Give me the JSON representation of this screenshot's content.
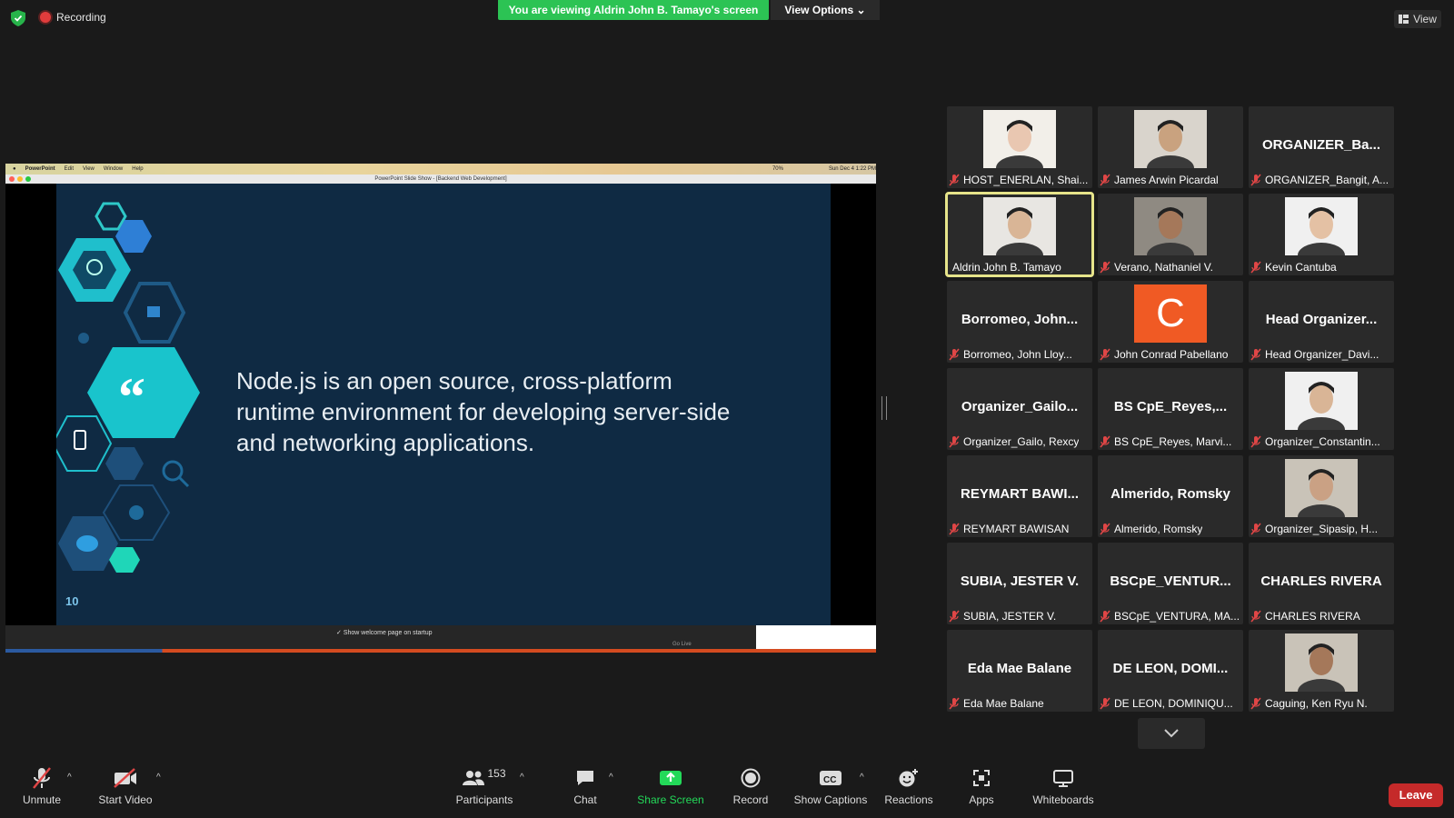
{
  "top": {
    "recording_label": "Recording",
    "viewing_banner": "You are viewing Aldrin John B. Tamayo's screen",
    "view_options_label": "View Options",
    "view_label": "View"
  },
  "shared_screen": {
    "mac_menu": {
      "app": "PowerPoint",
      "items": [
        "Edit",
        "View",
        "Window",
        "Help"
      ],
      "status": "70%",
      "clock": "Sun Dec 4  1:22 PM"
    },
    "window_title": "PowerPoint Slide Show - [Backend Web Development]",
    "slide_text": "Node.js is an open source, cross-platform runtime environment for developing server-side and networking applications.",
    "slide_number": "10",
    "behind_window_text": "Show welcome page on startup",
    "behind_window_go_live": "Go Live"
  },
  "gallery": {
    "tiles": [
      {
        "display": "",
        "label": "HOST_ENERLAN, Shai...",
        "has_video": true,
        "muted": true,
        "active": false
      },
      {
        "display": "",
        "label": "James Arwin Picardal",
        "has_video": true,
        "muted": true,
        "active": false
      },
      {
        "display": "ORGANIZER_Ba...",
        "label": "ORGANIZER_Bangit, A...",
        "has_video": false,
        "muted": true,
        "active": false
      },
      {
        "display": "",
        "label": "Aldrin John B. Tamayo",
        "has_video": true,
        "muted": false,
        "active": true
      },
      {
        "display": "",
        "label": "Verano, Nathaniel V.",
        "has_video": true,
        "muted": true,
        "active": false
      },
      {
        "display": "",
        "label": "Kevin Cantuba",
        "has_video": true,
        "muted": true,
        "active": false
      },
      {
        "display": "Borromeo,  John...",
        "label": "Borromeo, John Lloy...",
        "has_video": false,
        "muted": true,
        "active": false
      },
      {
        "display": "",
        "label": "John Conrad Pabellano",
        "has_video": false,
        "avatar_letter": "C",
        "muted": true,
        "active": false
      },
      {
        "display": "Head  Organizer...",
        "label": "Head Organizer_Davi...",
        "has_video": false,
        "muted": true,
        "active": false
      },
      {
        "display": "Organizer_Gailo...",
        "label": "Organizer_Gailo, Rexcy",
        "has_video": false,
        "muted": true,
        "active": false
      },
      {
        "display": "BS  CpE_Reyes,...",
        "label": "BS CpE_Reyes, Marvi...",
        "has_video": false,
        "muted": true,
        "active": false
      },
      {
        "display": "",
        "label": "Organizer_Constantin...",
        "has_video": true,
        "muted": true,
        "active": false
      },
      {
        "display": "REYMART  BAWI...",
        "label": "REYMART BAWISAN",
        "has_video": false,
        "muted": true,
        "active": false
      },
      {
        "display": "Almerido,  Romsky",
        "label": "Almerido, Romsky",
        "has_video": false,
        "muted": true,
        "active": false
      },
      {
        "display": "",
        "label": "Organizer_Sipasip, H...",
        "has_video": true,
        "muted": true,
        "active": false
      },
      {
        "display": "SUBIA,  JESTER V.",
        "label": "SUBIA, JESTER V.",
        "has_video": false,
        "muted": true,
        "active": false
      },
      {
        "display": "BSCpE_VENTUR...",
        "label": "BSCpE_VENTURA, MA...",
        "has_video": false,
        "muted": true,
        "active": false
      },
      {
        "display": "CHARLES RIVERA",
        "label": "CHARLES RIVERA",
        "has_video": false,
        "muted": true,
        "active": false
      },
      {
        "display": "Eda Mae Balane",
        "label": "Eda Mae Balane",
        "has_video": false,
        "muted": true,
        "active": false
      },
      {
        "display": "DE  LEON,  DOMI...",
        "label": "DE LEON, DOMINIQU...",
        "has_video": false,
        "muted": true,
        "active": false
      },
      {
        "display": "",
        "label": "Caguing, Ken Ryu N.",
        "has_video": true,
        "muted": true,
        "active": false
      }
    ]
  },
  "toolbar": {
    "unmute": "Unmute",
    "start_video": "Start Video",
    "participants": "Participants",
    "participants_count": "153",
    "chat": "Chat",
    "share_screen": "Share Screen",
    "record": "Record",
    "show_captions": "Show Captions",
    "reactions": "Reactions",
    "apps": "Apps",
    "whiteboards": "Whiteboards",
    "leave": "Leave"
  },
  "colors": {
    "banner_green": "#2cc354",
    "leave_red": "#c52a2a",
    "share_green": "#23d959",
    "mute_red": "#e04646",
    "active_outline": "#e6e48a",
    "slide_bg": "#0f2a43"
  }
}
